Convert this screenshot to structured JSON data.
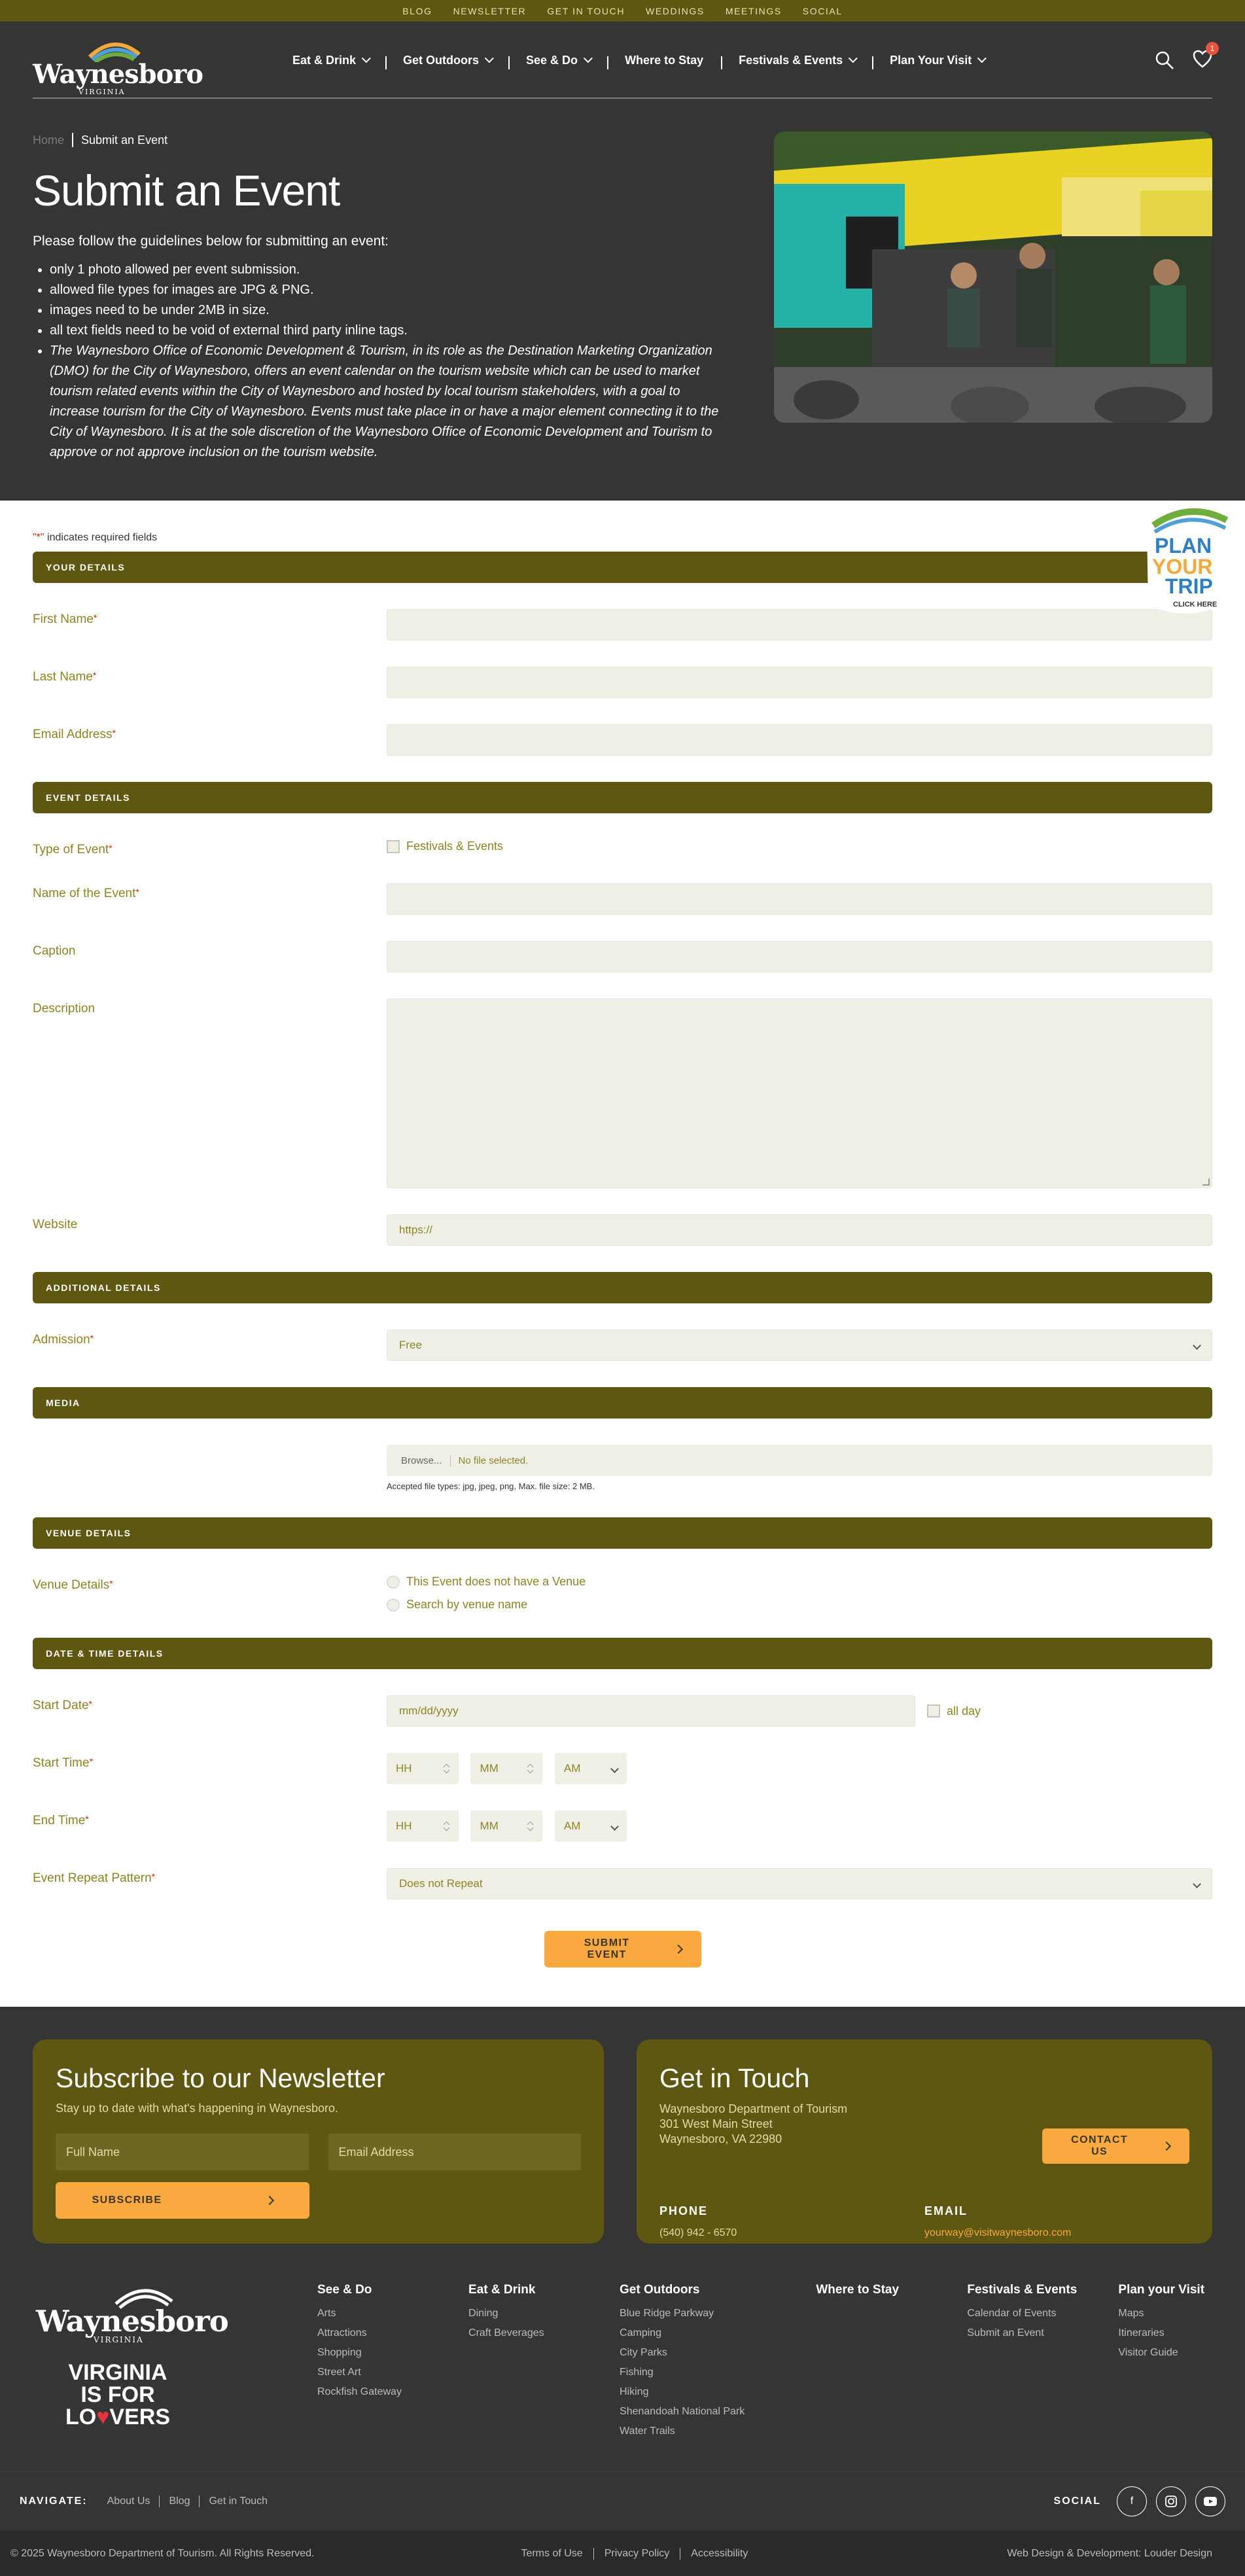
{
  "topbar": [
    "BLOG",
    "NEWSLETTER",
    "GET IN TOUCH",
    "WEDDINGS",
    "MEETINGS",
    "SOCIAL"
  ],
  "logo": {
    "word": "Waynesboro",
    "sub": "VIRGINIA"
  },
  "nav": [
    {
      "label": "Eat & Drink",
      "dropdown": true
    },
    {
      "label": "Get Outdoors",
      "dropdown": true
    },
    {
      "label": "See & Do",
      "dropdown": true
    },
    {
      "label": "Where to Stay",
      "dropdown": false
    },
    {
      "label": "Festivals & Events",
      "dropdown": true
    },
    {
      "label": "Plan Your Visit",
      "dropdown": true
    }
  ],
  "header": {
    "cart_count": "1"
  },
  "breadcrumb": {
    "home": "Home",
    "current": "Submit an Event"
  },
  "hero": {
    "title": "Submit an Event",
    "intro": "Please follow the guidelines below for submitting an event:",
    "guidelines": [
      "only 1 photo allowed per event submission.",
      "allowed file types for images are JPG & PNG.",
      "images need to be under 2MB in size.",
      "all text fields need to be void of external third party inline tags."
    ],
    "notice": "The Waynesboro Office of Economic Development & Tourism, in its role as the Destination Marketing Organization (DMO) for the City of Waynesboro, offers an event calendar on the tourism website which can be used to market tourism related events within the City of Waynesboro and hosted by local tourism stakeholders, with a goal to increase tourism for the City of Waynesboro. Events must take place in or have a major element connecting it to the City of Waynesboro. It is at the sole discretion of the Waynesboro Office of Economic Development and Tourism to approve or not approve inclusion on the tourism website."
  },
  "form": {
    "required_note": "indicates required fields",
    "required_mark": "\"*\"",
    "sections": {
      "your_details": "YOUR DETAILS",
      "event_details": "EVENT DETAILS",
      "additional_details": "ADDITIONAL DETAILS",
      "media": "MEDIA",
      "venue_details": "VENUE DETAILS",
      "date_time": "DATE & TIME DETAILS"
    },
    "first_name": "First Name",
    "last_name": "Last Name",
    "email": "Email Address",
    "type_of_event": "Type of Event",
    "type_option": "Festivals & Events",
    "event_name": "Name of the Event",
    "caption": "Caption",
    "description": "Description",
    "website": "Website",
    "website_placeholder": "https://",
    "admission": "Admission",
    "admission_value": "Free",
    "file_button": "Browse...",
    "file_none": "No file selected.",
    "file_help": "Accepted file types: jpg, jpeg, png, Max. file size: 2 MB.",
    "venue_label": "Venue Details",
    "venue_options": [
      "This Event does not have a Venue",
      "Search by venue name"
    ],
    "start_date": "Start Date",
    "date_placeholder": "mm/dd/yyyy",
    "all_day": "all day",
    "start_time": "Start Time",
    "end_time": "End Time",
    "hh": "HH",
    "mm": "MM",
    "ampm": "AM",
    "repeat": "Event Repeat Pattern",
    "repeat_value": "Does not Repeat",
    "submit": "SUBMIT EVENT"
  },
  "sticker": {
    "line1": "PLAN",
    "line2": "YOUR",
    "line3": "TRIP",
    "cta": "CLICK HERE"
  },
  "newsletter": {
    "title": "Subscribe to our Newsletter",
    "subtitle": "Stay up to date with what's happening in Waynesboro.",
    "name_placeholder": "Full Name",
    "email_placeholder": "Email Address",
    "button": "SUBSCRIBE"
  },
  "contact": {
    "title": "Get in Touch",
    "org": "Waynesboro Department of Tourism",
    "street": "301 West Main Street",
    "city": "Waynesboro, VA 22980",
    "button": "CONTACT US",
    "phone_label": "PHONE",
    "phone": "(540) 942 - 6570",
    "email_label": "EMAIL",
    "email": "yourway@visitwaynesboro.com"
  },
  "footer_logo": {
    "word": "Waynesboro",
    "sub": "VIRGINIA",
    "vfl1": "VIRGINIA",
    "vfl2": "IS FOR",
    "vfl3a": "LO",
    "vfl3b": "♥",
    "vfl3c": "VERS"
  },
  "footer_cols": [
    {
      "title": "See & Do",
      "links": [
        "Arts",
        "Attractions",
        "Shopping",
        "Street Art",
        "Rockfish Gateway"
      ]
    },
    {
      "title": "Eat & Drink",
      "links": [
        "Dining",
        "Craft Beverages"
      ]
    },
    {
      "title": "Get Outdoors",
      "links": [
        "Blue Ridge Parkway",
        "Camping",
        "City Parks",
        "Fishing",
        "Hiking",
        "Shenandoah National Park",
        "Water Trails"
      ]
    },
    {
      "title": "Where to Stay",
      "links": []
    },
    {
      "title": "Festivals & Events",
      "links": [
        "Calendar of Events",
        "Submit an Event"
      ]
    },
    {
      "title": "Plan your Visit",
      "links": [
        "Maps",
        "Itineraries",
        "Visitor Guide"
      ]
    }
  ],
  "navigate": {
    "label": "NAVIGATE:",
    "links": [
      "About Us",
      "Blog",
      "Get in Touch"
    ]
  },
  "social": {
    "label": "SOCIAL",
    "icons": [
      "facebook-icon",
      "instagram-icon",
      "youtube-icon"
    ]
  },
  "copyright": {
    "text": "© 2025 Waynesboro Department of Tourism. All Rights Reserved.",
    "legal": [
      "Terms of Use",
      "Privacy Policy",
      "Accessibility"
    ],
    "credit": "Web Design & Development: Louder Design"
  }
}
